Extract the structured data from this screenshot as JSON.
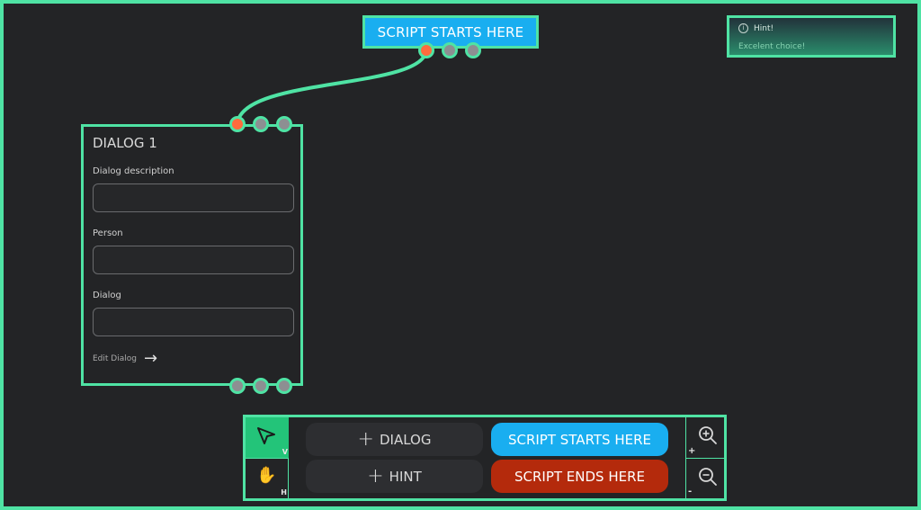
{
  "start_node": {
    "label": "SCRIPT STARTS HERE"
  },
  "hint": {
    "icon": "info-icon",
    "title": "Hint!",
    "text": "Excelent choice!"
  },
  "dialog_card": {
    "title": "DIALOG 1",
    "fields": [
      {
        "label": "Dialog description",
        "value": ""
      },
      {
        "label": "Person",
        "value": ""
      },
      {
        "label": "Dialog",
        "value": ""
      }
    ],
    "edit_link": "Edit Dialog"
  },
  "toolbar": {
    "select_key": "V",
    "hand_key": "H",
    "add_dialog": "DIALOG",
    "add_hint": "HINT",
    "script_start": "SCRIPT STARTS HERE",
    "script_end": "SCRIPT ENDS HERE",
    "zoom_in_key": "+",
    "zoom_out_key": "-"
  },
  "colors": {
    "accent": "#4fe3a4",
    "background": "#232426",
    "start": "#19aef0",
    "end": "#b42a0c",
    "active_port": "#ff6b3d",
    "select_tool": "#23c479"
  }
}
